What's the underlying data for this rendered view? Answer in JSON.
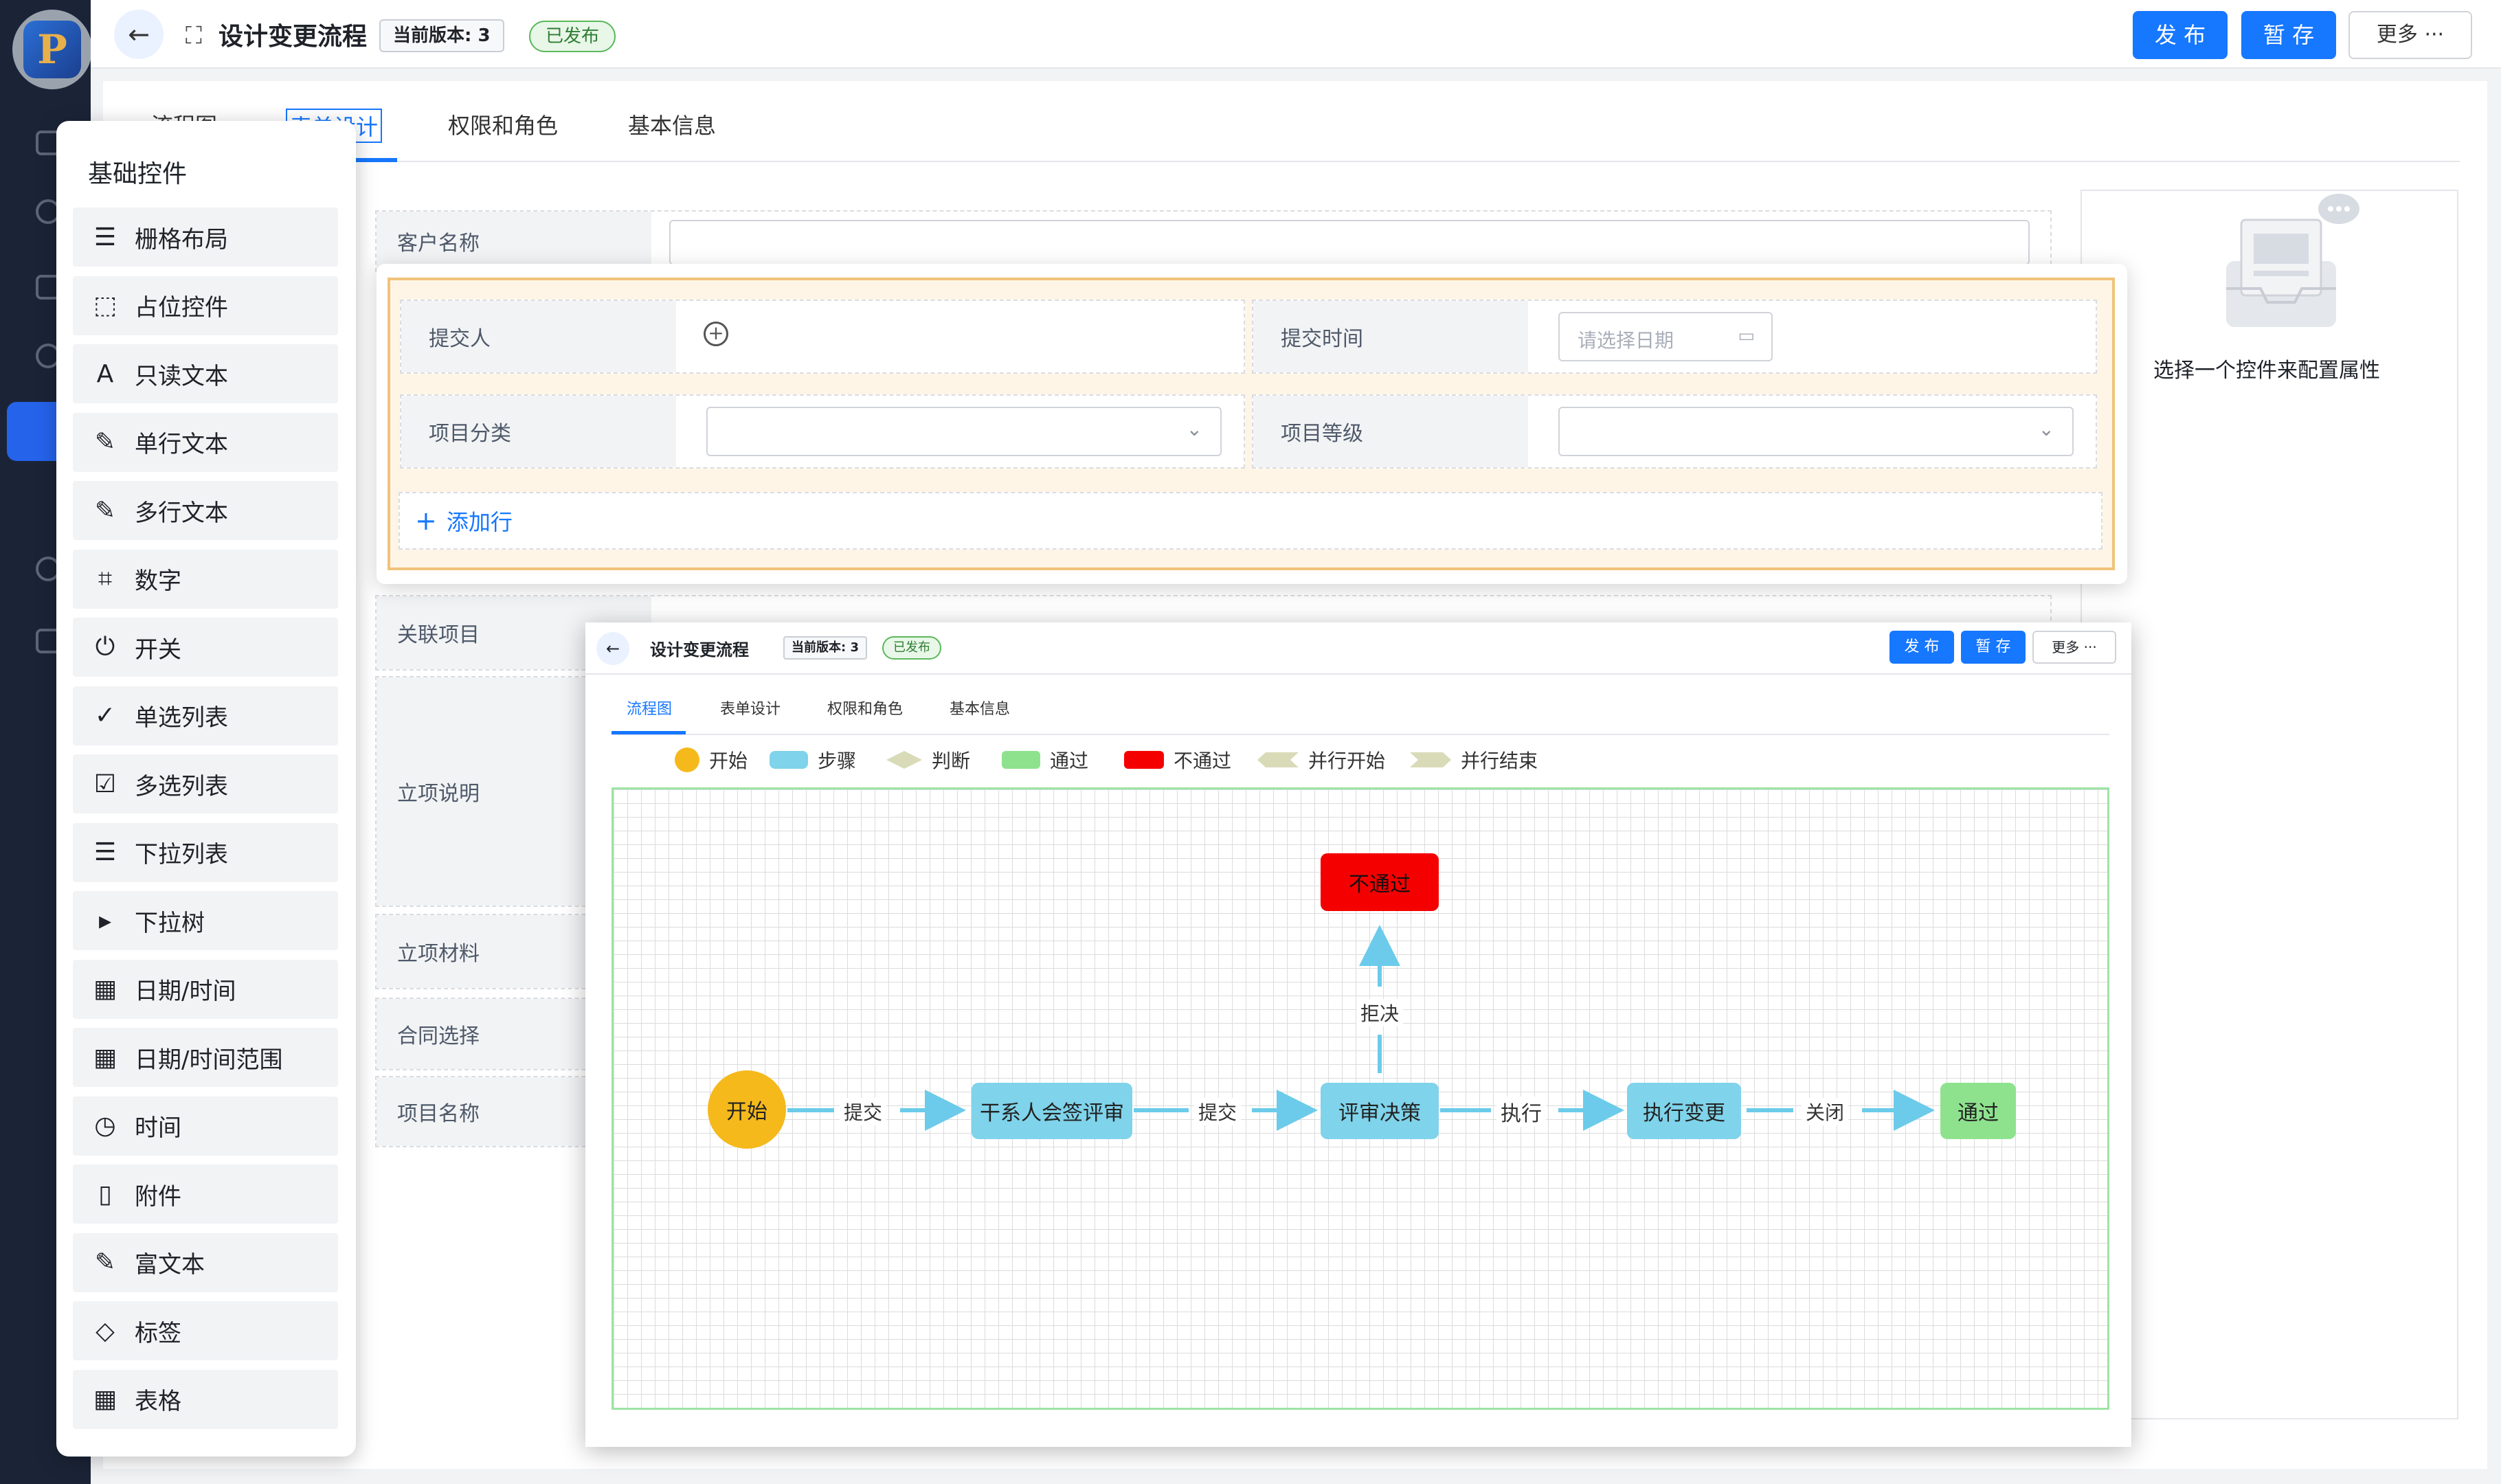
{
  "header": {
    "title": "设计变更流程",
    "version_label": "当前版本: 3",
    "status": "已发布",
    "publish_label": "发 布",
    "save_label": "暂 存",
    "more_label": "更多 ···"
  },
  "tabs": [
    {
      "label": "流程图"
    },
    {
      "label": "表单设计"
    },
    {
      "label": "权限和角色"
    },
    {
      "label": "基本信息"
    }
  ],
  "controls": {
    "title": "基础控件",
    "items": [
      {
        "label": "栅格布局",
        "icon": "grid-lines-icon"
      },
      {
        "label": "占位控件",
        "icon": "placeholder-icon"
      },
      {
        "label": "只读文本",
        "icon": "font-icon"
      },
      {
        "label": "单行文本",
        "icon": "pen-icon"
      },
      {
        "label": "多行文本",
        "icon": "pen-icon"
      },
      {
        "label": "数字",
        "icon": "number-icon"
      },
      {
        "label": "开关",
        "icon": "power-icon"
      },
      {
        "label": "单选列表",
        "icon": "check-circle-icon"
      },
      {
        "label": "多选列表",
        "icon": "check-square-icon"
      },
      {
        "label": "下拉列表",
        "icon": "list-icon"
      },
      {
        "label": "下拉树",
        "icon": "terminal-icon"
      },
      {
        "label": "日期/时间",
        "icon": "calendar-icon"
      },
      {
        "label": "日期/时间范围",
        "icon": "calendar-icon"
      },
      {
        "label": "时间",
        "icon": "clock-icon"
      },
      {
        "label": "附件",
        "icon": "file-icon"
      },
      {
        "label": "富文本",
        "icon": "edit-icon"
      },
      {
        "label": "标签",
        "icon": "tag-icon"
      },
      {
        "label": "表格",
        "icon": "table-icon"
      }
    ]
  },
  "form": {
    "customer_name": "客户名称",
    "related_project": "关联项目",
    "project_desc": "立项说明",
    "project_material": "立项材料",
    "contract_select": "合同选择",
    "project_name": "项目名称"
  },
  "subform": {
    "submitter": "提交人",
    "submit_time": "提交时间",
    "date_placeholder": "请选择日期",
    "category": "项目分类",
    "level": "项目等级",
    "add_row": "添加行"
  },
  "props": {
    "hint": "选择一个控件来配置属性"
  },
  "flow_window": {
    "title": "设计变更流程",
    "version_label": "当前版本: 3",
    "status": "已发布",
    "publish_label": "发 布",
    "save_label": "暂 存",
    "more_label": "更多 ···",
    "tabs": [
      {
        "label": "流程图"
      },
      {
        "label": "表单设计"
      },
      {
        "label": "权限和角色"
      },
      {
        "label": "基本信息"
      }
    ],
    "legend": [
      {
        "label": "开始",
        "color": "#f5b91c"
      },
      {
        "label": "步骤",
        "color": "#7fd3ea"
      },
      {
        "label": "判断",
        "color": "#d9dbb8"
      },
      {
        "label": "通过",
        "color": "#8ee28e"
      },
      {
        "label": "不通过",
        "color": "#f50000"
      },
      {
        "label": "并行开始",
        "color": "#d9dbb8"
      },
      {
        "label": "并行结束",
        "color": "#d9dbb8"
      }
    ],
    "nodes": {
      "start": "开始",
      "step1": "干系人会签评审",
      "step2": "评审决策",
      "step3": "执行变更",
      "pass": "通过",
      "reject": "不通过"
    },
    "edges": {
      "submit1": "提交",
      "submit2": "提交",
      "execute": "执行",
      "close": "关闭",
      "refuse": "拒决"
    }
  },
  "colors": {
    "primary": "#1677ff",
    "start": "#f5b91c",
    "step": "#7fd3ea",
    "pass": "#8ee28e",
    "reject": "#f50000",
    "arrow": "#6ccbea"
  }
}
